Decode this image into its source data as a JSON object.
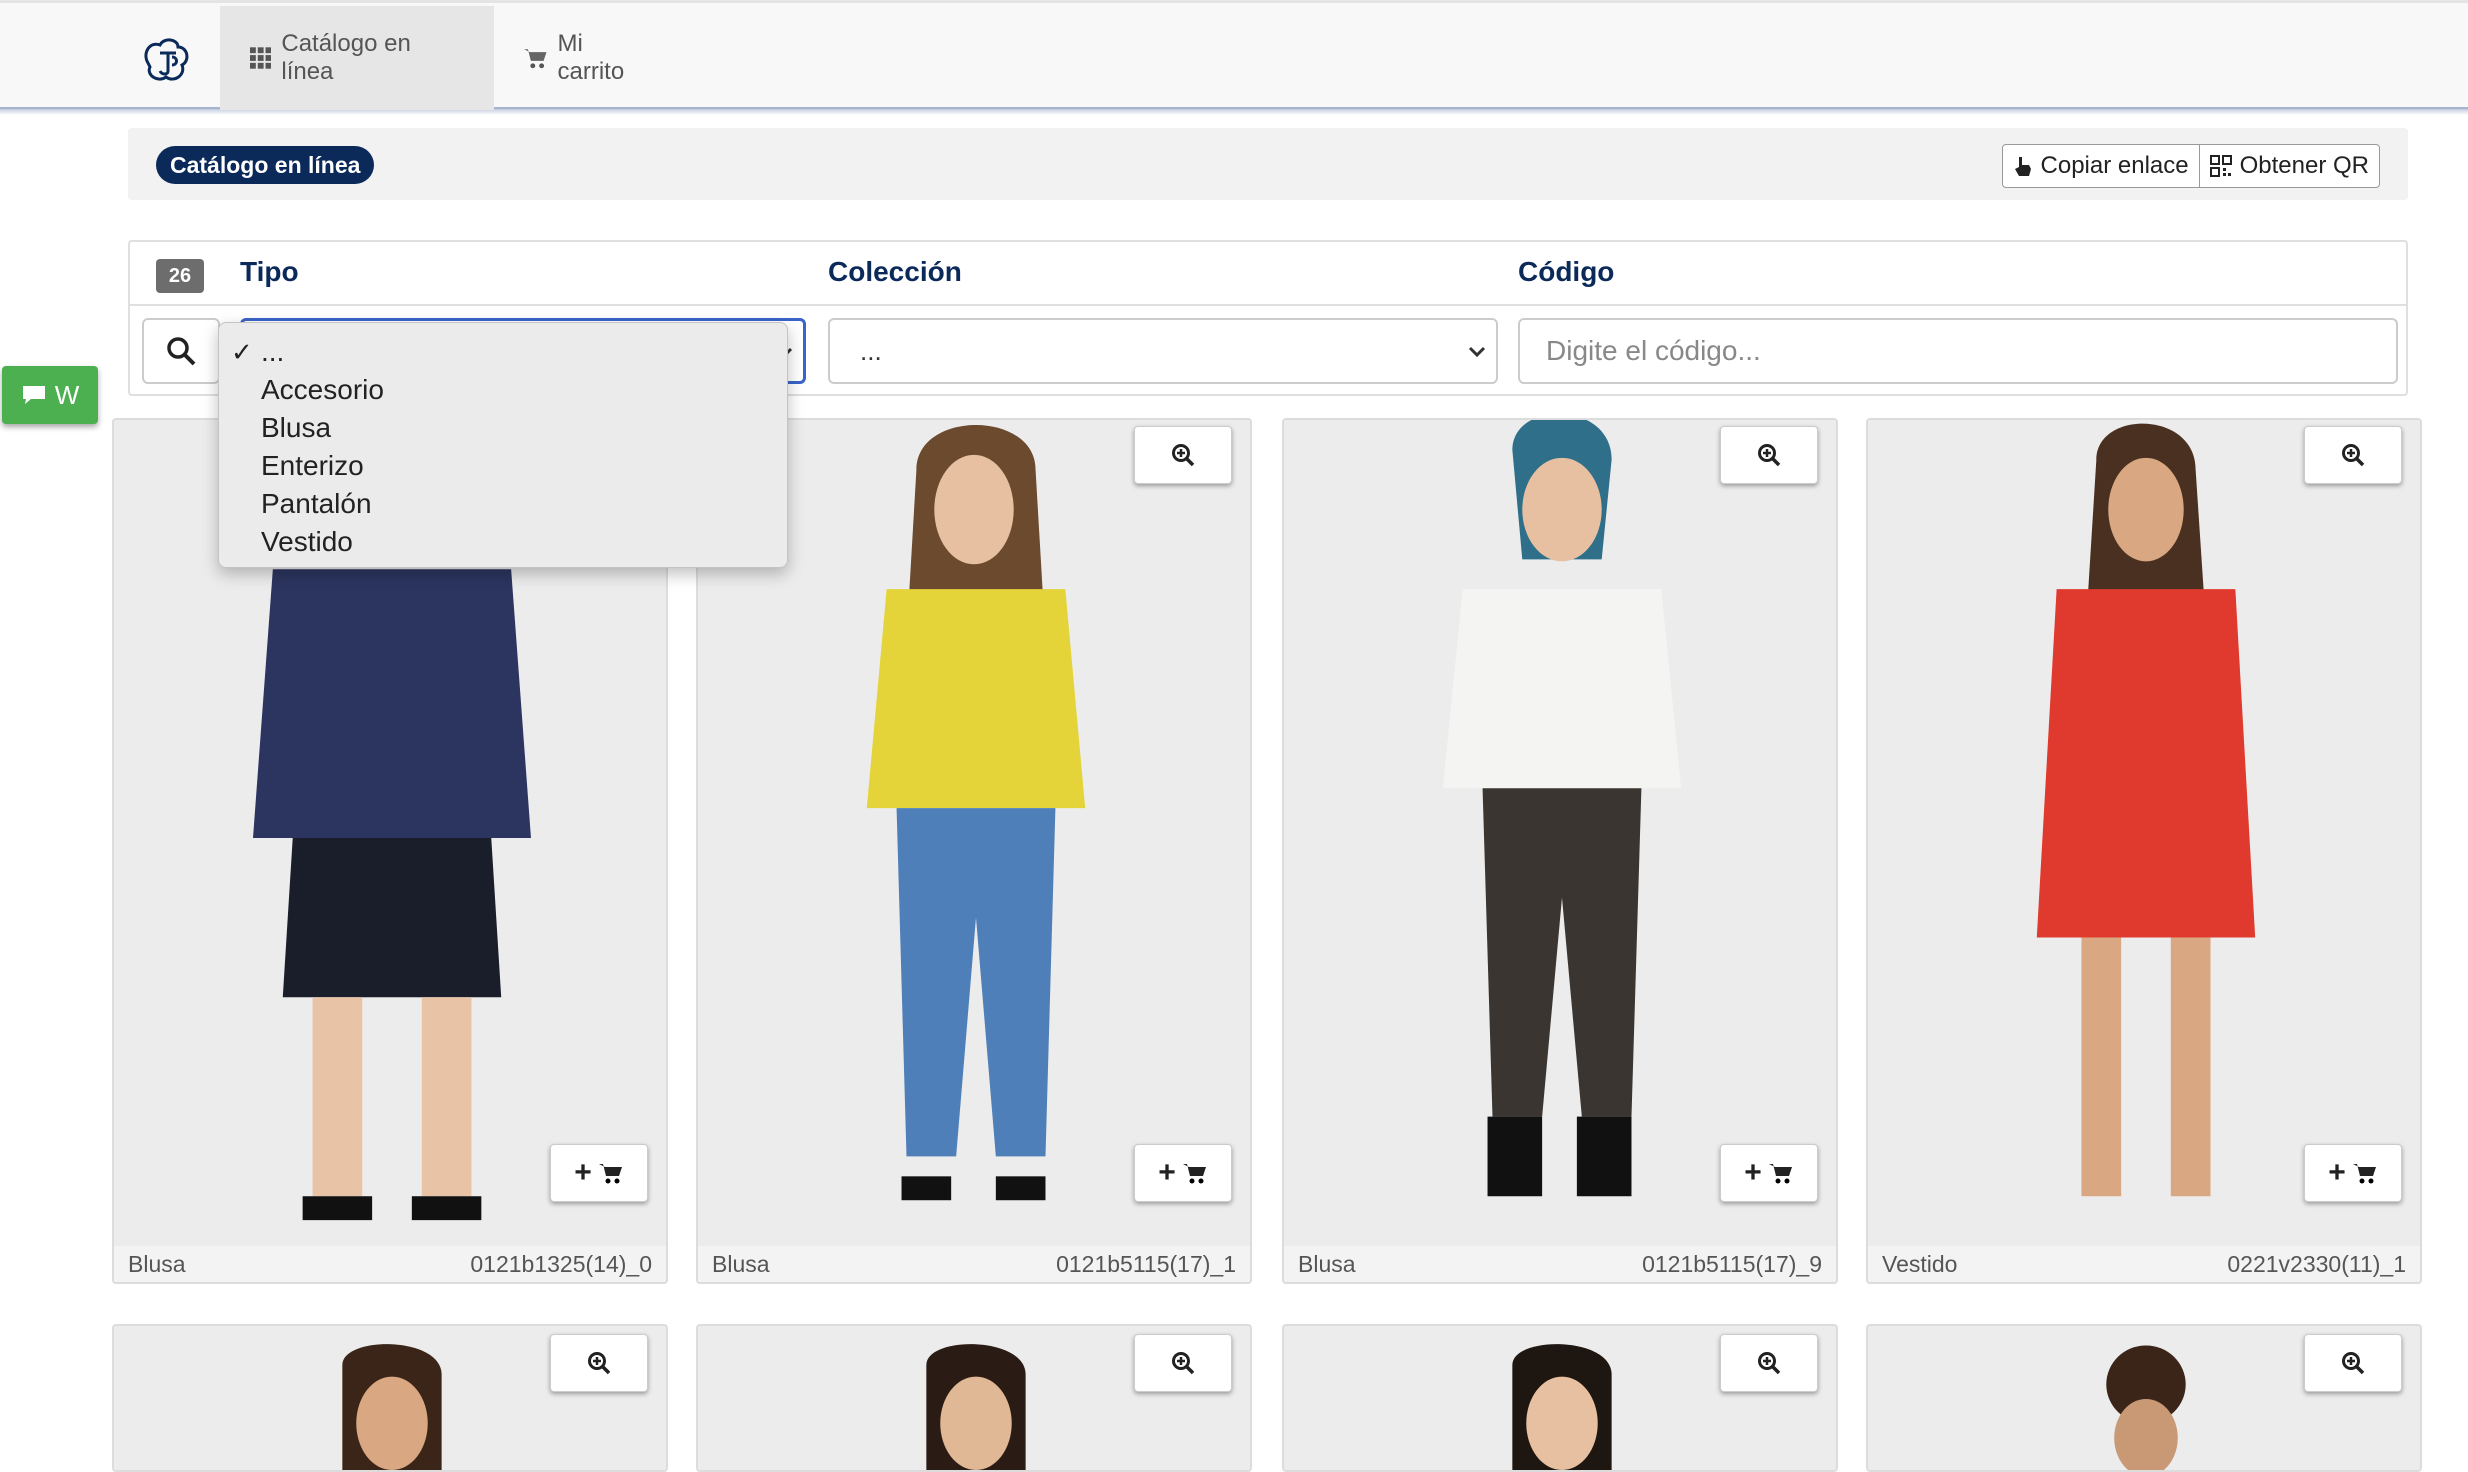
{
  "nav": {
    "logo_icon": "logo-icon",
    "tabs": [
      {
        "label": "Catálogo en línea",
        "icon": "grid-icon",
        "active": true
      },
      {
        "label": "Mi carrito",
        "icon": "cart-icon",
        "active": false
      }
    ]
  },
  "header": {
    "badge": "Catálogo en línea",
    "copy_link": "Copiar enlace",
    "get_qr": "Obtener QR"
  },
  "filters": {
    "count": "26",
    "tipo_label": "Tipo",
    "coleccion_label": "Colección",
    "codigo_label": "Código",
    "tipo_selected": "...",
    "coleccion_selected": "...",
    "codigo_placeholder": "Digite el código...",
    "tipo_options": [
      "...",
      "Accesorio",
      "Blusa",
      "Enterizo",
      "Pantalón",
      "Vestido"
    ],
    "tipo_checked": "✓"
  },
  "whatsapp": {
    "label": "W",
    "icon": "chat-icon"
  },
  "products": [
    {
      "type": "Blusa",
      "code": "0121b1325(14)_0",
      "top": "#2c3560",
      "bottom": "#1a1d2a"
    },
    {
      "type": "Blusa",
      "code": "0121b5115(17)_1",
      "top": "#e4d43a",
      "bottom": "#4f7fb8"
    },
    {
      "type": "Blusa",
      "code": "0121b5115(17)_9",
      "top": "#f4f4f2",
      "bottom": "#3a3530"
    },
    {
      "type": "Vestido",
      "code": "0221v2330(11)_1",
      "top": "#e03a2e",
      "bottom": "#e03a2e"
    }
  ],
  "colors": {
    "brand": "#0b2a5a",
    "whatsapp": "#4caf50",
    "focus": "#3a64c8"
  }
}
